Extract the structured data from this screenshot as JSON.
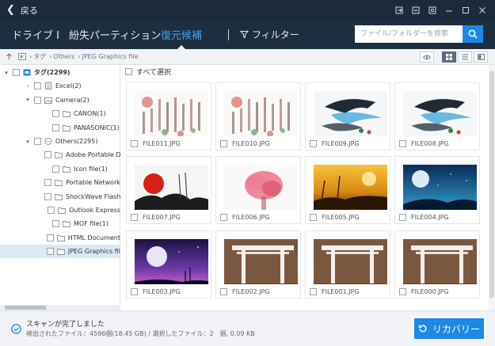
{
  "topbar": {
    "back_label": "戻る"
  },
  "nav": {
    "tabs": [
      {
        "label": "ドライブ I",
        "active": false
      },
      {
        "label": "紛失パーティション",
        "active": false
      },
      {
        "label": "復元候補",
        "active": true
      }
    ],
    "filter_label": "フィルター",
    "search_placeholder": "ファイル/フォルダーを検索"
  },
  "breadcrumb": [
    "タグ",
    "Others",
    "JPEG Graphics file"
  ],
  "sidebar": {
    "items": [
      {
        "label": "タグ(2299)",
        "level": 0,
        "expanded": true,
        "icon": "tag-icon",
        "bold": true
      },
      {
        "label": "Excel(2)",
        "level": 1,
        "expanded": false,
        "icon": "excel-file-icon"
      },
      {
        "label": "Camera(2)",
        "level": 1,
        "expanded": true,
        "icon": "camera-icon"
      },
      {
        "label": "CANON(1)",
        "level": 2,
        "icon": "folder-icon"
      },
      {
        "label": "PANASONIC(1)",
        "level": 2,
        "icon": "folder-icon"
      },
      {
        "label": "Others(2295)",
        "level": 1,
        "expanded": true,
        "icon": "others-icon"
      },
      {
        "label": "Adobe Portable D",
        "level": 2,
        "icon": "folder-icon"
      },
      {
        "label": "Icon file(1)",
        "level": 2,
        "icon": "folder-icon"
      },
      {
        "label": "Portable Network",
        "level": 2,
        "icon": "folder-icon"
      },
      {
        "label": "ShockWave Flash",
        "level": 2,
        "icon": "folder-icon"
      },
      {
        "label": "Outlook Express",
        "level": 2,
        "icon": "folder-icon"
      },
      {
        "label": "MOF file(1)",
        "level": 2,
        "icon": "folder-icon"
      },
      {
        "label": "HTML Document",
        "level": 2,
        "icon": "folder-icon"
      },
      {
        "label": "JPEG Graphics fil",
        "level": 2,
        "icon": "folder-icon",
        "selected": true
      }
    ]
  },
  "content": {
    "select_all_label": "すべて選択",
    "files": [
      {
        "name": "FILE011.JPG",
        "thumb": "blurred-calligraphy"
      },
      {
        "name": "FILE010.JPG",
        "thumb": "blurred-calligraphy"
      },
      {
        "name": "FILE009.JPG",
        "thumb": "ink-bird"
      },
      {
        "name": "FILE008.JPG",
        "thumb": "ink-bird"
      },
      {
        "name": "FILE007.JPG",
        "thumb": "red-sun-ink"
      },
      {
        "name": "FILE006.JPG",
        "thumb": "pink-tree"
      },
      {
        "name": "FILE005.JPG",
        "thumb": "golden-sunset"
      },
      {
        "name": "FILE004.JPG",
        "thumb": "blue-moon"
      },
      {
        "name": "FILE003.JPG",
        "thumb": "purple-moon"
      },
      {
        "name": "FILE002.JPG",
        "thumb": "gate"
      },
      {
        "name": "FILE001.JPG",
        "thumb": "gate"
      },
      {
        "name": "FILE000.JPG",
        "thumb": "gate"
      }
    ]
  },
  "status": {
    "title": "スキャンが完了しました",
    "detail": "検出されたファイル：4596個(18.45 GB) / 選択したファイル：2　個, 0.09 KB",
    "recover_label": "リカバリー"
  },
  "colors": {
    "accent": "#1e88e5",
    "active_tab": "#3ea3f3",
    "header": "#1e2e41"
  }
}
